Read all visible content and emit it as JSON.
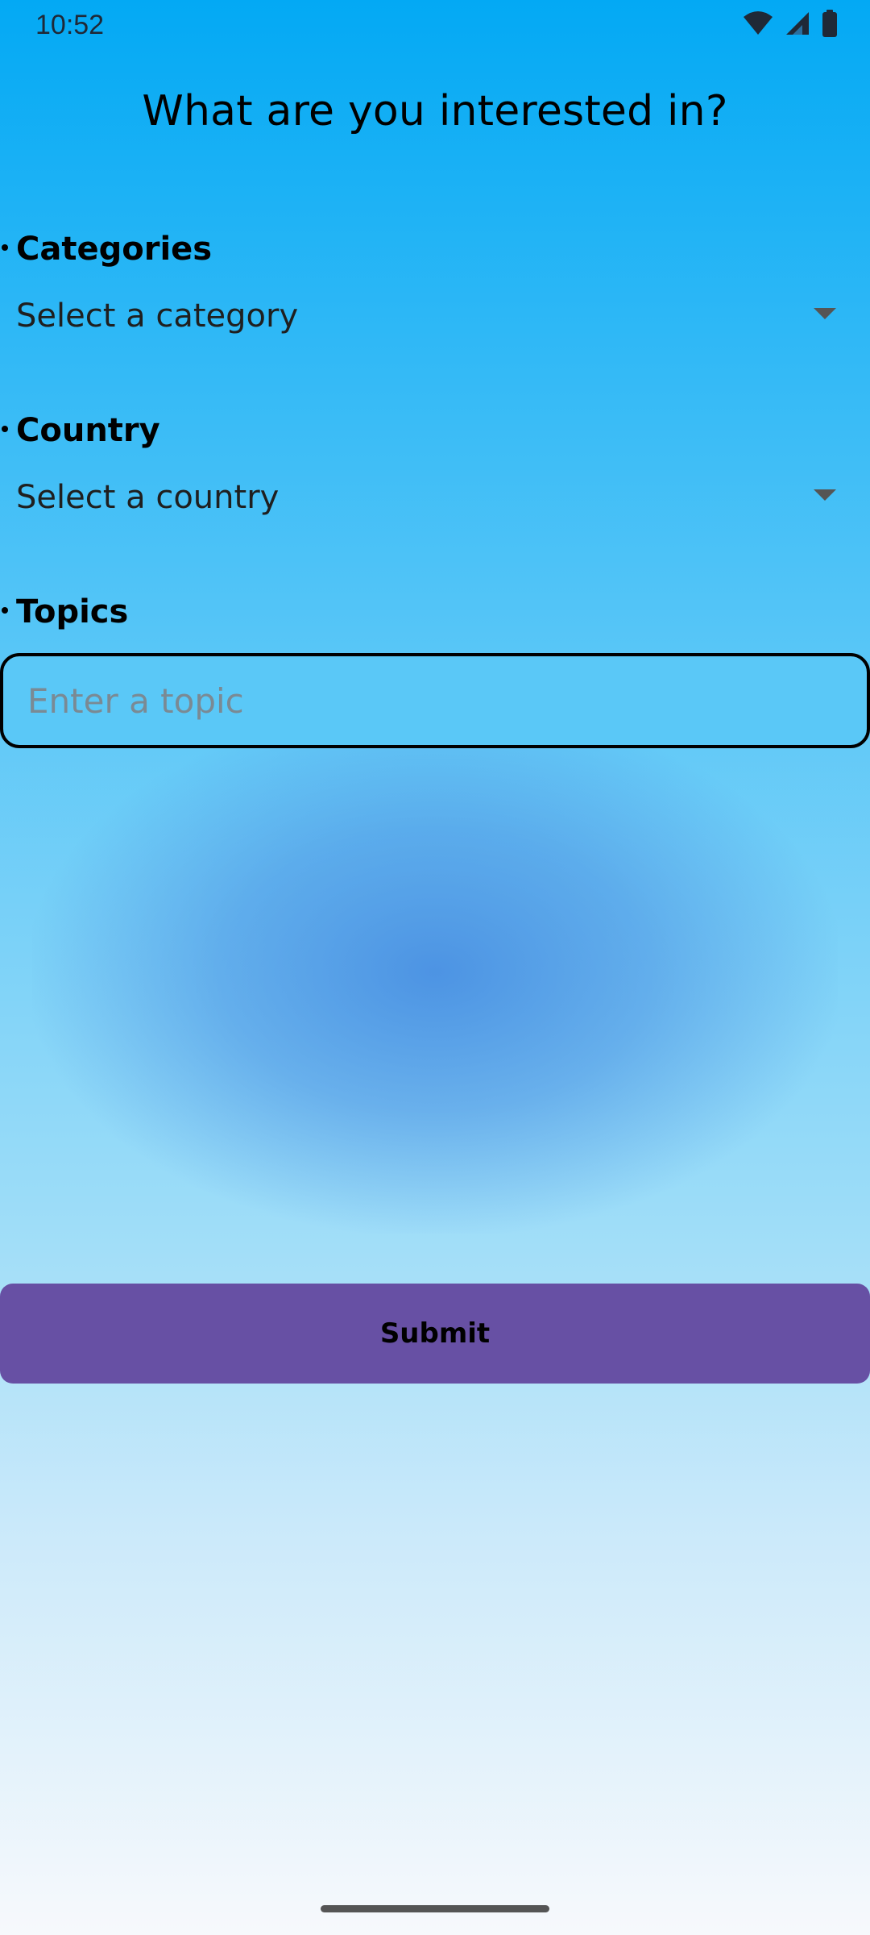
{
  "status_bar": {
    "time": "10:52",
    "icons": [
      "wifi-icon",
      "cellular-signal-icon",
      "battery-icon"
    ]
  },
  "title": "What are you interested in?",
  "categories": {
    "label": "Categories",
    "selected": "Select a category",
    "icon": "dropdown-arrow-icon"
  },
  "country": {
    "label": "Country",
    "selected": "Select a country",
    "icon": "dropdown-arrow-icon"
  },
  "topics": {
    "label": "Topics",
    "value": "",
    "placeholder": "Enter a topic"
  },
  "submit": {
    "label": "Submit"
  },
  "colors": {
    "background_top": "#03a9f4",
    "background_bottom": "#f7f9fc",
    "glow": "#4a90e2",
    "submit_button": "#6750a4"
  }
}
